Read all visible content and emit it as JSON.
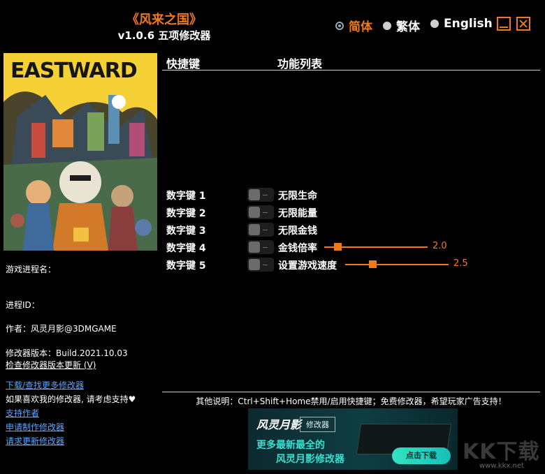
{
  "header": {
    "title": "《风来之国》",
    "subtitle": "v1.0.6 五项修改器"
  },
  "languages": [
    {
      "label": "简体",
      "selected": true
    },
    {
      "label": "繁体",
      "selected": false
    },
    {
      "label": "English",
      "selected": false
    }
  ],
  "window": {
    "minimize_icon": "minimize-icon",
    "close_icon": "close-icon"
  },
  "cover": {
    "logo_text": "EASTWARD"
  },
  "info": {
    "process_name": "游戏进程名：",
    "process_id": "进程ID：",
    "author": "作者：风灵月影@3DMGAME",
    "version": "修改器版本：Build.2021.10.03",
    "check_update": "检查修改器版本更新 (V)",
    "download_more": "下载/查找更多修改器",
    "support_text": "如果喜欢我的修改器, 请考虑支持♥",
    "support_author": "支持作者",
    "request_make": "申请制作修改器",
    "request_update": "请求更新修改器"
  },
  "table": {
    "col_hotkey": "快捷键",
    "col_features": "功能列表",
    "rows": [
      {
        "hotkey": "数字键 1",
        "feature": "无限生命"
      },
      {
        "hotkey": "数字键 2",
        "feature": "无限能量"
      },
      {
        "hotkey": "数字键 3",
        "feature": "无限金钱"
      },
      {
        "hotkey": "数字键 4",
        "feature": "金钱倍率",
        "slider_value": "2.0",
        "slider_fraction": 0.1
      },
      {
        "hotkey": "数字键 5",
        "feature": "设置游戏速度",
        "slider_value": "2.5",
        "slider_fraction": 0.25
      }
    ]
  },
  "footer": {
    "note": "其他说明：Ctrl+Shift+Home禁用/启用快捷键；免费修改器，希望玩家广告支持！"
  },
  "banner": {
    "brand": "风灵月影",
    "tag": "修改器",
    "line1": "更多最新最全的",
    "line2": "风灵月影修改器",
    "button": "点击下载"
  },
  "watermark": {
    "text": "KK下载",
    "url": "www.kkx.net"
  },
  "colors": {
    "accent": "#f07a17",
    "link": "#5aa7ff",
    "background": "#000000"
  }
}
